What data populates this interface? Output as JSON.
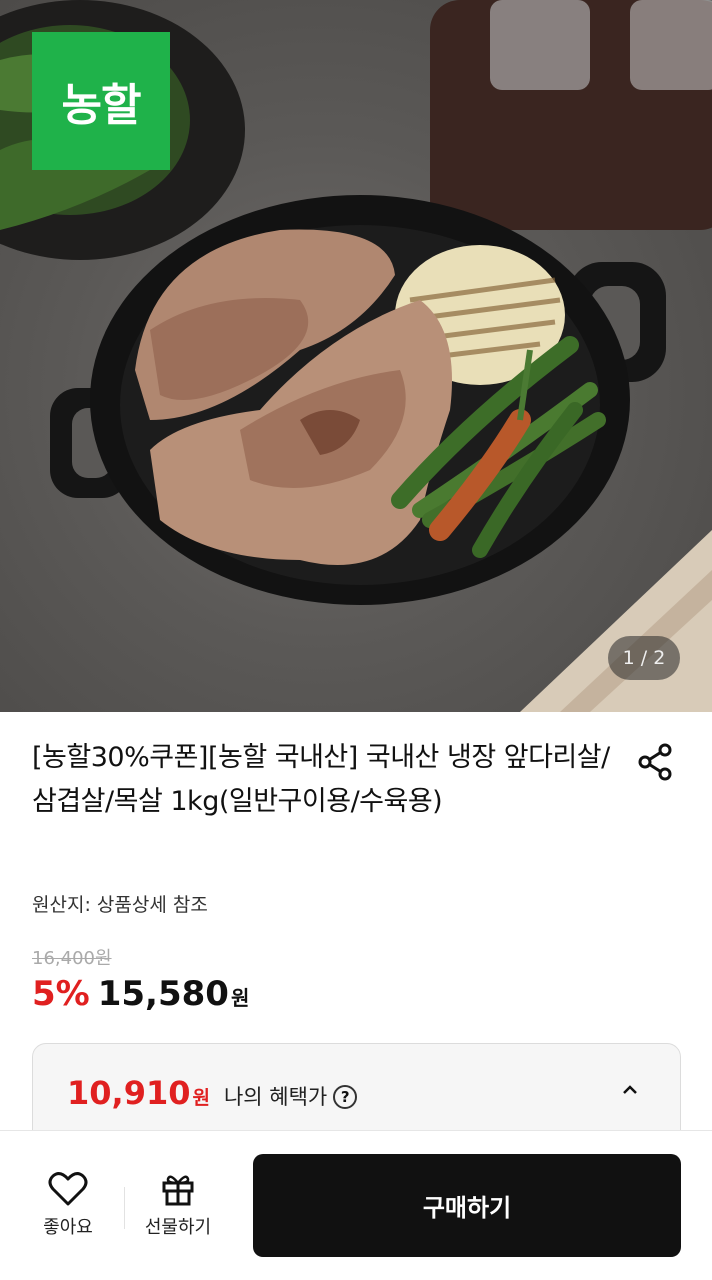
{
  "hero": {
    "brand_badge": "농할",
    "page_indicator": "1 / 2"
  },
  "product": {
    "title": "[농할30%쿠폰][농할 국내산] 국내산 냉장 앞다리살/삼겹살/목살 1kg(일반구이용/수육용)",
    "origin": "원산지: 상품상세 참조",
    "original_price": "16,400원",
    "discount_rate": "5%",
    "sale_price": "15,580",
    "currency": "원"
  },
  "benefit": {
    "price": "10,910",
    "currency": "원",
    "label": "나의 혜택가",
    "help_symbol": "?"
  },
  "bottom_bar": {
    "like_label": "좋아요",
    "gift_label": "선물하기",
    "buy_label": "구매하기"
  },
  "colors": {
    "brand_green": "#1fb24a",
    "discount_red": "#e02020",
    "buy_button": "#111111"
  }
}
